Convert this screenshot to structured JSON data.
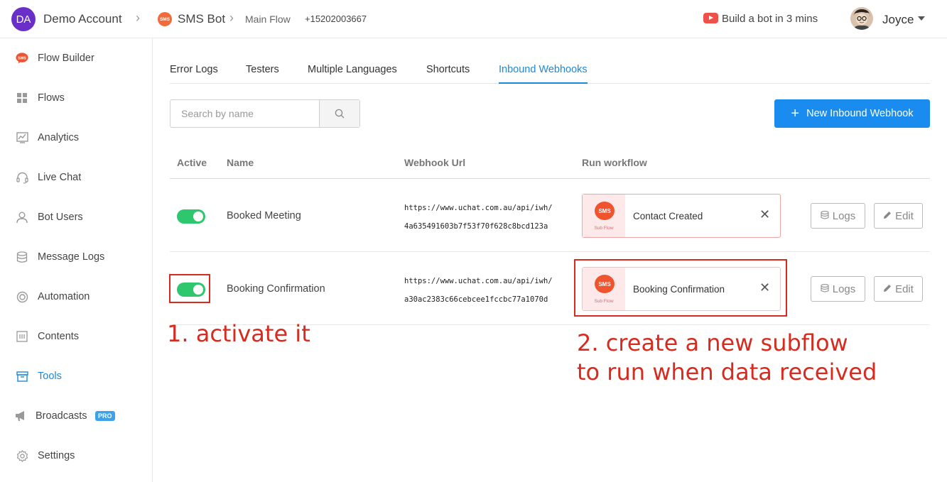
{
  "header": {
    "account_initials": "DA",
    "account_name": "Demo Account",
    "bot_icon_text": "SMS",
    "bot_name": "SMS Bot",
    "flow_name": "Main Flow",
    "phone": "+15202003667",
    "build_link": "Build a bot in 3 mins",
    "user_name": "Joyce"
  },
  "sidebar": {
    "items": [
      {
        "label": "Flow Builder",
        "icon": "sms-icon"
      },
      {
        "label": "Flows",
        "icon": "grid-icon"
      },
      {
        "label": "Analytics",
        "icon": "chart-icon"
      },
      {
        "label": "Live Chat",
        "icon": "headset-icon"
      },
      {
        "label": "Bot Users",
        "icon": "user-icon"
      },
      {
        "label": "Message Logs",
        "icon": "database-icon"
      },
      {
        "label": "Automation",
        "icon": "lifebuoy-icon"
      },
      {
        "label": "Contents",
        "icon": "contents-icon"
      },
      {
        "label": "Tools",
        "icon": "toolbox-icon",
        "active": true
      },
      {
        "label": "Broadcasts",
        "icon": "megaphone-icon",
        "badge": "PRO"
      },
      {
        "label": "Settings",
        "icon": "gear-icon"
      }
    ]
  },
  "tabs": [
    "Error Logs",
    "Testers",
    "Multiple Languages",
    "Shortcuts",
    "Inbound Webhooks"
  ],
  "active_tab": "Inbound Webhooks",
  "search": {
    "placeholder": "Search by name"
  },
  "new_button": {
    "label": "New Inbound Webhook"
  },
  "table": {
    "headers": [
      "Active",
      "Name",
      "Webhook Url",
      "Run workflow"
    ],
    "rows": [
      {
        "active": true,
        "name": "Booked Meeting",
        "url_line1": "https://www.uchat.com.au/api/iwh/",
        "url_line2": "4a635491603b7f53f70f628c8bcd123a",
        "workflow_icon_text": "SMS",
        "workflow_type": "Sub Flow",
        "workflow": "Contact Created",
        "logs_label": "Logs",
        "edit_label": "Edit"
      },
      {
        "active": true,
        "name": "Booking Confirmation",
        "url_line1": "https://www.uchat.com.au/api/iwh/",
        "url_line2": "a30ac2383c66cebcee1fccbc77a1070d",
        "workflow_icon_text": "SMS",
        "workflow_type": "Sub Flow",
        "workflow": "Booking Confirmation",
        "logs_label": "Logs",
        "edit_label": "Edit"
      }
    ]
  },
  "annotations": {
    "step1": "1. activate it",
    "step2_line1": "2. create a new subflow",
    "step2_line2": "to run when data received"
  },
  "colors": {
    "accent": "#1a8cf0",
    "toggle_on": "#2ec76e",
    "annotation": "#d72b1f",
    "sms_brand": "#f0542e"
  }
}
